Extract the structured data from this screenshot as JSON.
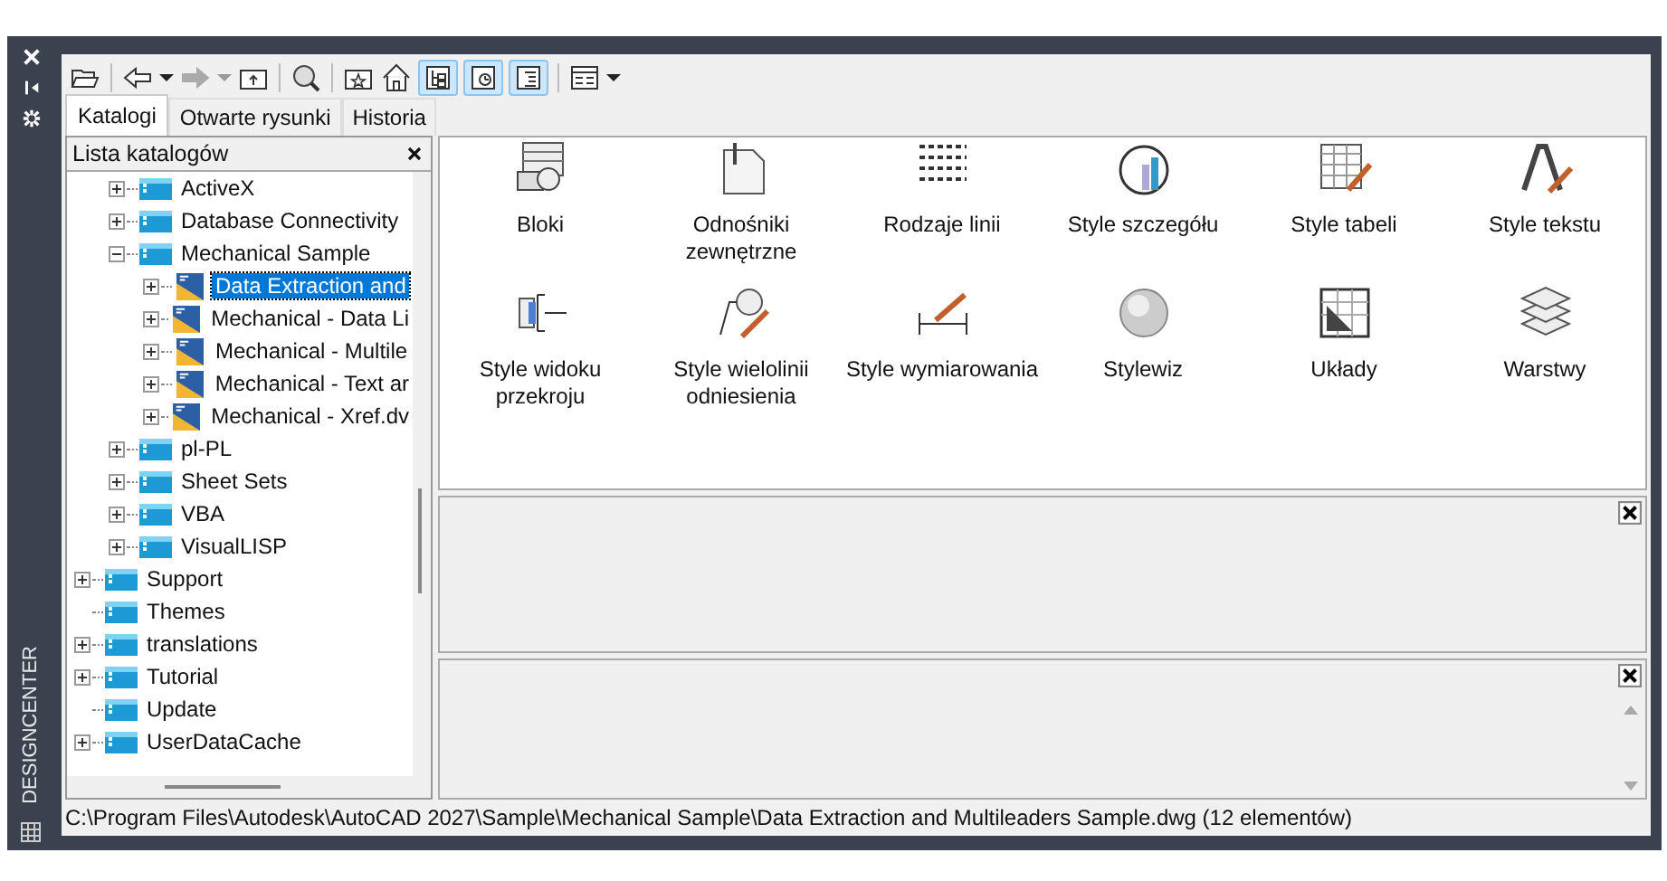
{
  "sidebar": {
    "label": "DESIGNCENTER"
  },
  "toolbar": {
    "forward_enabled": false,
    "toggles": [
      {
        "on": true
      },
      {
        "on": true
      },
      {
        "on": true
      }
    ]
  },
  "tabs": [
    {
      "label": "Katalogi",
      "selected": true
    },
    {
      "label": "Otwarte rysunki",
      "selected": false
    },
    {
      "label": "Historia",
      "selected": false
    }
  ],
  "tree": {
    "title": "Lista katalogów",
    "items": [
      {
        "children": [
          {
            "label": "ActiveX",
            "kind": "folder",
            "expandable": true,
            "expanded": false,
            "selected": false
          },
          {
            "label": "Database Connectivity",
            "kind": "folder",
            "expandable": true,
            "expanded": false,
            "selected": false
          },
          {
            "label": "Mechanical Sample",
            "kind": "folder",
            "expandable": true,
            "expanded": true,
            "selected": false,
            "children": [
              {
                "label": "Data Extraction and",
                "kind": "drawing",
                "expandable": true,
                "expanded": false,
                "selected": true
              },
              {
                "label": "Mechanical - Data Li",
                "kind": "drawing",
                "expandable": true,
                "expanded": false,
                "selected": false
              },
              {
                "label": "Mechanical - Multile",
                "kind": "drawing",
                "expandable": true,
                "expanded": false,
                "selected": false
              },
              {
                "label": "Mechanical - Text ar",
                "kind": "drawing",
                "expandable": true,
                "expanded": false,
                "selected": false
              },
              {
                "label": "Mechanical - Xref.dv",
                "kind": "drawing",
                "expandable": true,
                "expanded": false,
                "selected": false
              }
            ]
          },
          {
            "label": "pl-PL",
            "kind": "folder",
            "expandable": true,
            "expanded": false,
            "selected": false
          },
          {
            "label": "Sheet Sets",
            "kind": "folder",
            "expandable": true,
            "expanded": false,
            "selected": false
          },
          {
            "label": "VBA",
            "kind": "folder",
            "expandable": true,
            "expanded": false,
            "selected": false
          },
          {
            "label": "VisualLISP",
            "kind": "folder",
            "expandable": true,
            "expanded": false,
            "selected": false
          }
        ]
      },
      {
        "label": "Support",
        "kind": "folder",
        "expandable": true,
        "expanded": false,
        "selected": false
      },
      {
        "label": "Themes",
        "kind": "folder",
        "expandable": false,
        "selected": false
      },
      {
        "label": "translations",
        "kind": "folder",
        "expandable": true,
        "expanded": false,
        "selected": false
      },
      {
        "label": "Tutorial",
        "kind": "folder",
        "expandable": true,
        "expanded": false,
        "selected": false
      },
      {
        "label": "Update",
        "kind": "folder",
        "expandable": false,
        "selected": false
      },
      {
        "label": "UserDataCache",
        "kind": "folder",
        "expandable": true,
        "expanded": false,
        "selected": false
      }
    ]
  },
  "content": {
    "items": [
      {
        "label": "Bloki"
      },
      {
        "label": "Odnośniki zewnętrzne"
      },
      {
        "label": "Rodzaje linii"
      },
      {
        "label": "Style szczegółu"
      },
      {
        "label": "Style tabeli"
      },
      {
        "label": "Style tekstu"
      },
      {
        "label": "Style widoku przekroju"
      },
      {
        "label": "Style wielolinii odniesienia"
      },
      {
        "label": "Style wymiarowania"
      },
      {
        "label": "Stylewiz"
      },
      {
        "label": "Układy"
      },
      {
        "label": "Warstwy"
      }
    ]
  },
  "status_bar": {
    "path": "C:\\Program Files\\Autodesk\\AutoCAD 2027\\Sample\\Mechanical Sample\\Data Extraction and Multileaders Sample.dwg (12 elementów)"
  }
}
